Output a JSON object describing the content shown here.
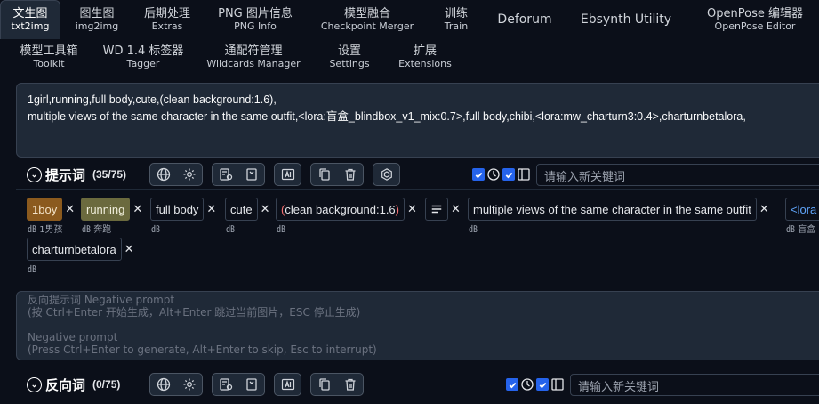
{
  "tabs_row1": [
    {
      "zh": "文生图",
      "en": "txt2img",
      "active": true
    },
    {
      "zh": "图生图",
      "en": "img2img"
    },
    {
      "zh": "后期处理",
      "en": "Extras"
    },
    {
      "zh": "PNG 图片信息",
      "en": "PNG Info"
    },
    {
      "zh": "模型融合",
      "en": "Checkpoint Merger"
    },
    {
      "zh": "训练",
      "en": "Train"
    },
    {
      "zh": "Deforum",
      "en": ""
    },
    {
      "zh": "Ebsynth Utility",
      "en": ""
    },
    {
      "zh": "OpenPose 编辑器",
      "en": "OpenPose Editor"
    }
  ],
  "tabs_row2": [
    {
      "zh": "模型工具箱",
      "en": "Toolkit"
    },
    {
      "zh": "WD 1.4 标签器",
      "en": "Tagger"
    },
    {
      "zh": "通配符管理",
      "en": "Wildcards Manager"
    },
    {
      "zh": "设置",
      "en": "Settings"
    },
    {
      "zh": "扩展",
      "en": "Extensions"
    }
  ],
  "prompt": {
    "line1": "1girl,running,full body,cute,(clean background:1.6),",
    "line2": "multiple views of the same character in the same outfit,<lora:盲盒_blindbox_v1_mix:0.7>,full body,chibi,<lora:mw_charturn3:0.4>,charturnbetalora,"
  },
  "positive_toolbar": {
    "title": "提示词",
    "count": "(35/75)",
    "keyword_placeholder": "请输入新关键词"
  },
  "negative_toolbar": {
    "title": "反向词",
    "count": "(0/75)",
    "keyword_placeholder": "请输入新关键词"
  },
  "tags": [
    {
      "label": "1boy",
      "sub": "1男孩",
      "style": "brown"
    },
    {
      "label": "running",
      "sub": "奔跑",
      "style": "olive"
    },
    {
      "label": "full body",
      "sub": ""
    },
    {
      "label": "cute",
      "sub": ""
    },
    {
      "label": "clean background:1.6",
      "paren_open": "(",
      "paren_close": ")",
      "sub": ""
    },
    {
      "label": "",
      "sub": ""
    },
    {
      "label": "multiple views of the same character in the same outfit",
      "sub": ""
    },
    {
      "label": "<lora",
      "sub": "盲盒",
      "style": "blue"
    },
    {
      "label": "charturnbetalora",
      "sub": ""
    }
  ],
  "negative_prompt": {
    "placeholder_zh_1": "反向提示词 Negative prompt",
    "placeholder_zh_2": "(按 Ctrl+Enter 开始生成，Alt+Enter 跳过当前图片，ESC 停止生成)",
    "placeholder_en_1": "Negative prompt",
    "placeholder_en_2": "(Press Ctrl+Enter to generate, Alt+Enter to skip, Esc to interrupt)"
  },
  "colors": {
    "background": "#0b0f19",
    "panel": "#1f2937",
    "accent_checkbox": "#2563eb",
    "tag_brown": "#8b5a1e",
    "tag_olive": "#6b6a3e",
    "paren_red": "#f87171"
  }
}
